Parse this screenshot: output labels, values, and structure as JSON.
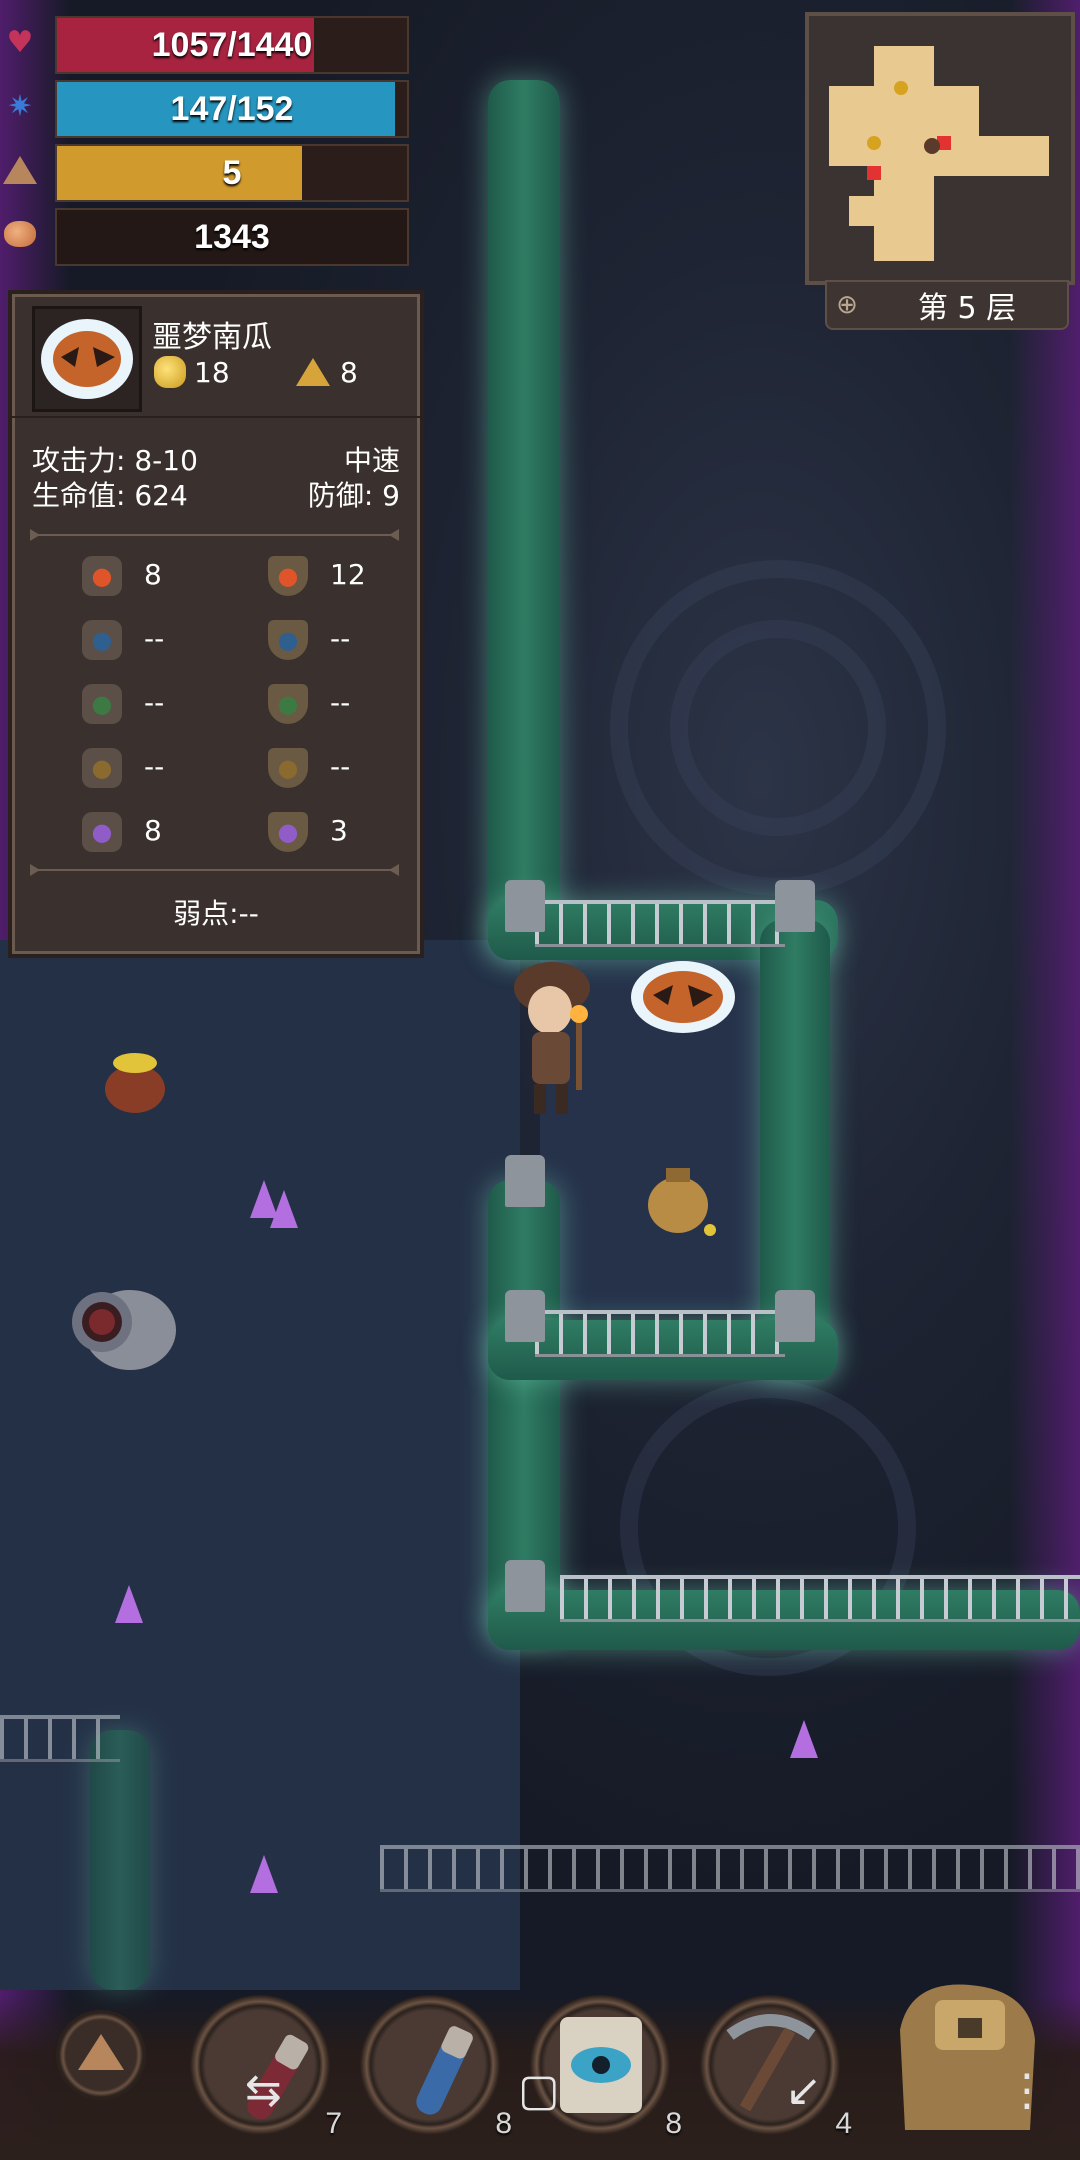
{
  "hud": {
    "hp": {
      "text": "1057/1440",
      "fraction": 0.734,
      "color": "#a7233f",
      "icon": "heart-icon"
    },
    "mp": {
      "text": "147/152",
      "fraction": 0.967,
      "color": "#2696c1",
      "icon": "sparkle-icon"
    },
    "level": {
      "text": "5",
      "fraction": 0.7,
      "color": "#d09a2c",
      "icon": "triangle-icon"
    },
    "gold": {
      "text": "1343",
      "icon": "ore-icon"
    }
  },
  "minimap": {
    "floor_label": "第 5 层",
    "zoom_icon": "magnifier-icon"
  },
  "monster": {
    "name": "噩梦南瓜",
    "gold": "18",
    "exp": "8",
    "attack_label": "攻击力: 8-10",
    "speed": "中速",
    "hp_label": "生命值: 624",
    "defense_label": "防御: 9",
    "resistances": [
      {
        "element": "fire",
        "atk": "8",
        "def": "12",
        "color": "#e0542a"
      },
      {
        "element": "water",
        "atk": "--",
        "def": "--",
        "color": "#2f5f8f"
      },
      {
        "element": "nature",
        "atk": "--",
        "def": "--",
        "color": "#3d7a43"
      },
      {
        "element": "earth",
        "atk": "--",
        "def": "--",
        "color": "#8a6a2e"
      },
      {
        "element": "shadow",
        "atk": "8",
        "def": "3",
        "color": "#8f5cc8"
      }
    ],
    "weakness": "弱点:--"
  },
  "toolbar": {
    "slots": [
      {
        "item": "red-potion",
        "count": "7"
      },
      {
        "item": "blue-potion",
        "count": "8"
      },
      {
        "item": "eye-scroll",
        "count": "8"
      },
      {
        "item": "pickaxe",
        "count": "4"
      }
    ]
  }
}
